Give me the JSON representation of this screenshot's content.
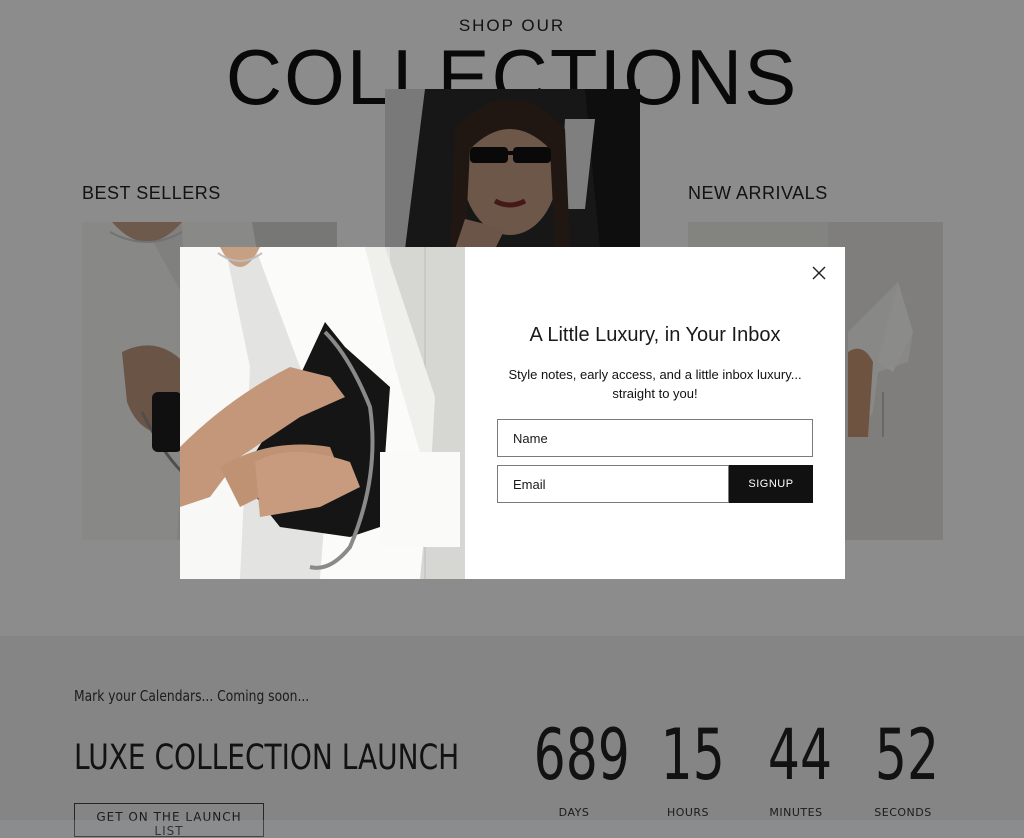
{
  "collections": {
    "eyebrow": "SHOP OUR",
    "title": "COLLECTIONS",
    "best_sellers_label": "BEST SELLERS",
    "new_arrivals_label": "NEW ARRIVALS"
  },
  "launch": {
    "kicker": "Mark your Calendars... Coming soon...",
    "title": "LUXE COLLECTION LAUNCH",
    "button_label": "GET ON THE LAUNCH LIST",
    "countdown": [
      {
        "value": "689",
        "unit": "DAYS"
      },
      {
        "value": "15",
        "unit": "HOURS"
      },
      {
        "value": "44",
        "unit": "MINUTES"
      },
      {
        "value": "52",
        "unit": "SECONDS"
      }
    ]
  },
  "modal": {
    "title": "A Little Luxury, in Your Inbox",
    "text": "Style notes, early access, and a little inbox luxury... straight to you!",
    "name_placeholder": "Name",
    "email_placeholder": "Email",
    "signup_label": "SIGNUP",
    "close_icon": "close-icon"
  },
  "colors": {
    "overlay": "#000000",
    "footer_bg": "#f2f2f2",
    "button_bg": "#111111"
  }
}
